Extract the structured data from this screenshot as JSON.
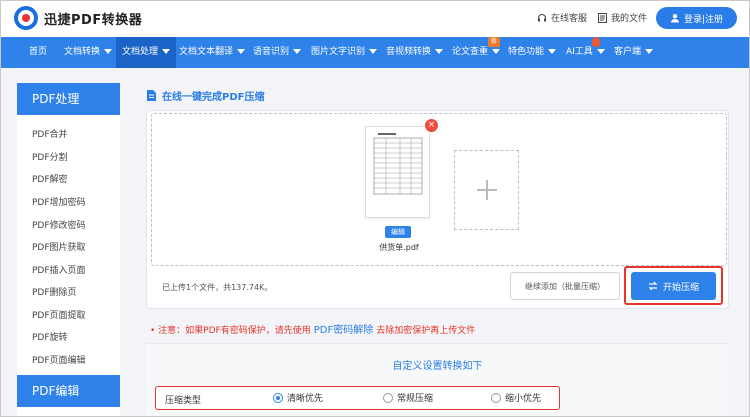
{
  "header": {
    "logo_text": "迅捷PDF转换器",
    "service_label": "在线客服",
    "files_label": "我的文件",
    "login_label": "登录|注册"
  },
  "nav": {
    "items": [
      "首页",
      "文档转换",
      "文档处理",
      "文档文本翻译",
      "语音识别",
      "图片文字识别",
      "音视频转换",
      "论文查重",
      "特色功能",
      "AI工具",
      "客户端"
    ],
    "new_badge": "新"
  },
  "sidebar": {
    "section1_title": "PDF处理",
    "items": [
      "PDF合并",
      "PDF分割",
      "PDF解密",
      "PDF增加密码",
      "PDF修改密码",
      "PDF图片获取",
      "PDF插入页面",
      "PDF删除页",
      "PDF页面提取",
      "PDF旋转",
      "PDF页面编辑"
    ],
    "section2_title": "PDF编辑"
  },
  "main": {
    "title": "在线一键完成PDF压缩",
    "file": {
      "tag": "编辑",
      "name": "供货单.pdf",
      "delete_icon": "×"
    },
    "status": "已上传1个文件，共137.74K。",
    "continue_label": "继续添加（批量压缩）",
    "start_label": "开始压缩",
    "notice_before": "注意：如果PDF有密码保护，请先使用",
    "notice_link": "PDF密码解除",
    "notice_after": "去除加密保护再上传文件"
  },
  "settings": {
    "title": "自定义设置转换如下",
    "compress_label": "压缩类型",
    "options": [
      "清晰优先",
      "常规压缩",
      "缩小优先"
    ],
    "selected": "清晰优先"
  },
  "colors": {
    "brand_blue": "#2f82ea",
    "nav_active": "#1c63c8",
    "alert_red": "#e8342a"
  }
}
